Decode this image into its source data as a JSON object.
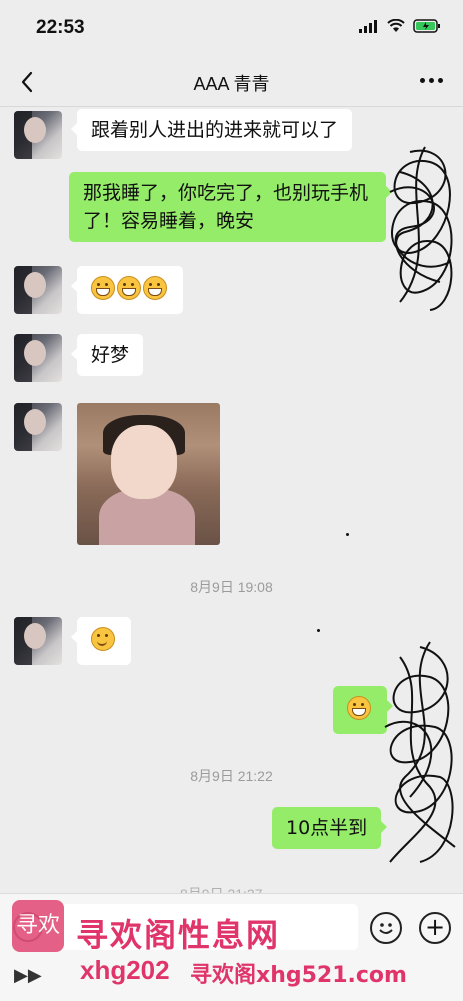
{
  "status_bar": {
    "time": "22:53"
  },
  "nav": {
    "title": "AAA 青青"
  },
  "messages": {
    "m1": "跟着别人进出的进来就可以了",
    "m2": "那我睡了，你吃完了，也别玩手机了！容易睡着，晚安",
    "m4": "好梦",
    "m9": "10点半到"
  },
  "timestamps": {
    "t1": "8月9日 19:08",
    "t2": "8月9日 21:22",
    "t3": "8月9日 21:27"
  },
  "watermark": {
    "logo_text": "寻欢",
    "main": "寻欢阁性息网",
    "bottom_left": "xhg202",
    "bottom_right": "寻欢阁xhg521.com"
  },
  "icons": [
    "back-icon",
    "more-icon",
    "wifi-icon",
    "battery-icon",
    "voice-icon",
    "emoji-icon",
    "plus-icon"
  ]
}
